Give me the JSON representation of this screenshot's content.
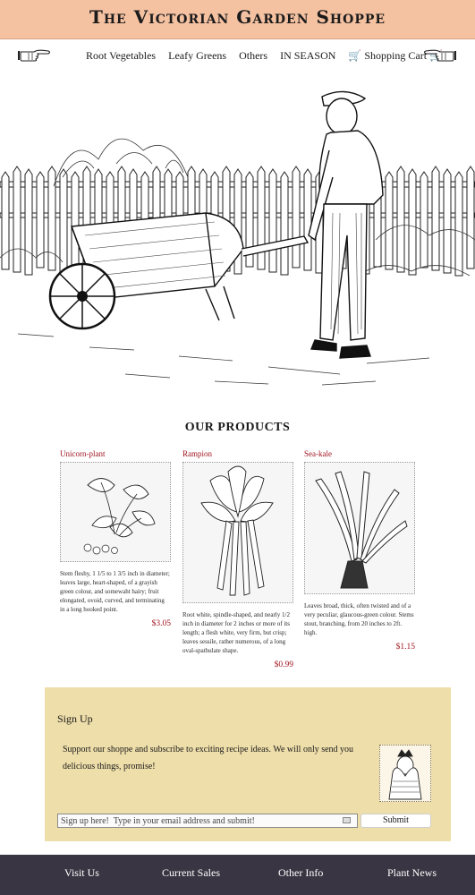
{
  "site": {
    "title": "The Victorian Garden Shoppe"
  },
  "nav": {
    "items": [
      "Root Vegetables",
      "Leafy Greens",
      "Others",
      "IN SEASON"
    ],
    "cart_label": "Shopping Cart",
    "cart_icon": "shopping-cart-icon"
  },
  "products": {
    "heading": "OUR PRODUCTS",
    "items": [
      {
        "name": "Unicorn-plant",
        "description": "Stem fleshy, 1 1/5 to 1 3/5 inch in diameter; leaves large, heart-shaped, of a grayish green colour, and somewaht hairy; fruit elongated, ovoid, curved, and terminating in a long hooked point.",
        "price": "$3.05"
      },
      {
        "name": "Rampion",
        "description": "Root white, spindle-shaped, and nearly 1/2 inch in diameter for 2 inches or more of its length; a flesh white, very firm, but crisp; leaves sessile, rather numerous, of a long oval-spathulate shape.",
        "price": "$0.99"
      },
      {
        "name": "Sea-kale",
        "description": "Leaves broad, thick, often twisted and of a very peculiar, glaucous-green colour. Stems stout, branching, from 20 inches to 2ft. high.",
        "price": "$1.15"
      }
    ]
  },
  "signup": {
    "heading": "Sign Up",
    "text": "Support our shoppe and subscribe to exciting recipe ideas. We will only send you delicious things, promise!",
    "email_placeholder": "Sign up here!  Type in your email address and submit!",
    "submit_label": "Submit"
  },
  "footer": {
    "links": [
      "Visit Us",
      "Current Sales",
      "Other Info",
      "Plant News"
    ]
  },
  "colors": {
    "title_bar": "#f4c1a1",
    "accent": "#a0141e",
    "signup_bg": "#eedeaa",
    "footer_bg": "#3a3542"
  }
}
